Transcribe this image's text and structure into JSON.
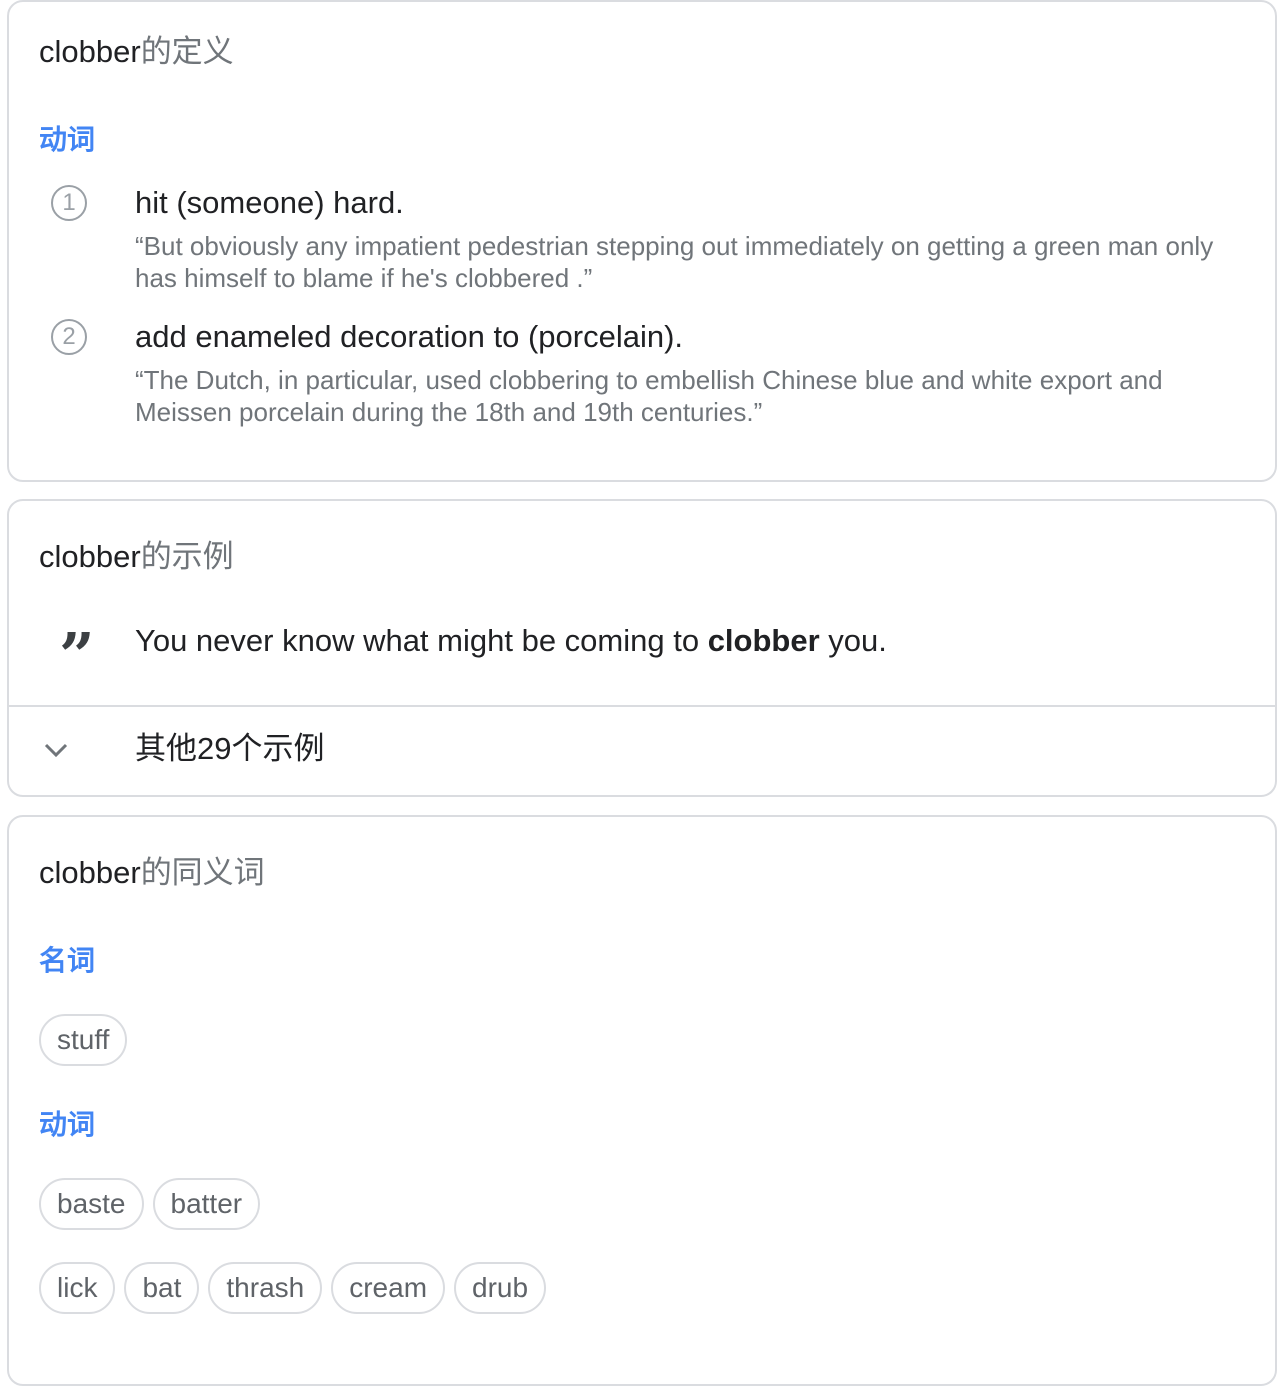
{
  "definitions_card": {
    "title_word": "clobber",
    "title_suffix": "的定义",
    "part_of_speech": "动词",
    "senses": [
      {
        "number": "1",
        "definition": "hit (someone) hard.",
        "example": "“But obviously any impatient pedestrian stepping out immediately on getting a green man only has himself to blame if he's clobbered .”"
      },
      {
        "number": "2",
        "definition": "add enameled decoration to (porcelain).",
        "example": "“The Dutch, in particular, used clobbering to embellish Chinese blue and white export and Meissen porcelain during the 18th and 19th centuries.”"
      }
    ]
  },
  "examples_card": {
    "title_word": "clobber",
    "title_suffix": "的示例",
    "quote_icon": "quote-icon",
    "sentence_before": "You never know what might be coming to ",
    "sentence_keyword": "clobber",
    "sentence_after": " you.",
    "more_label": "其他29个示例",
    "expand_icon": "chevron-down-icon"
  },
  "synonyms_card": {
    "title_word": "clobber",
    "title_suffix": "的同义词",
    "groups": [
      {
        "part_of_speech": "名词",
        "rows": [
          [
            "stuff"
          ]
        ]
      },
      {
        "part_of_speech": "动词",
        "rows": [
          [
            "baste",
            "batter"
          ],
          [
            "lick",
            "bat",
            "thrash",
            "cream",
            "drub"
          ]
        ]
      }
    ]
  }
}
